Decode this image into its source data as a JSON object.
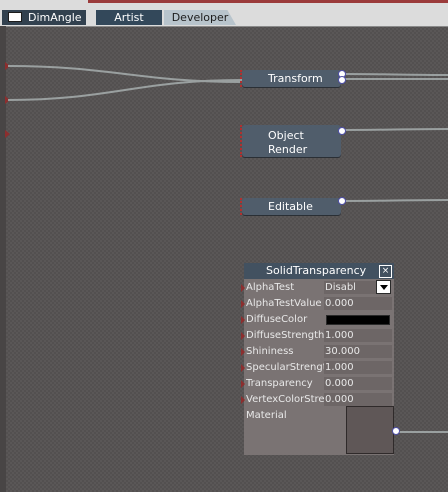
{
  "tabs": {
    "dimangle": "DimAngle",
    "artist": "Artist",
    "developer": "Developer"
  },
  "nodes": {
    "transform": "Transform",
    "object_render_line1": "Object",
    "object_render_line2": "Render",
    "editable": "Editable"
  },
  "panel": {
    "title": "SolidTransparency",
    "close": "×",
    "rows": [
      {
        "name": "AlphaTest",
        "value": "Disabl"
      },
      {
        "name": "AlphaTestValue",
        "value": "0.000"
      },
      {
        "name": "DiffuseColor",
        "value": ""
      },
      {
        "name": "DiffuseStrength",
        "value": "1.000"
      },
      {
        "name": "Shininess",
        "value": "30.000"
      },
      {
        "name": "SpecularStrengt",
        "value": "1.000"
      },
      {
        "name": "Transparency",
        "value": "0.000"
      },
      {
        "name": "VertexColorStre",
        "value": "0.000"
      },
      {
        "name": "Material",
        "value": ""
      }
    ],
    "diffuse_color": "#000000"
  },
  "colors": {
    "node_bg": "#505d6b",
    "panel_bg": "#7a7373",
    "panel_title_bg": "#425160",
    "port_red": "#8c2e2e",
    "wire": "#9aa0a0"
  },
  "icons": [
    "window-icon",
    "close-icon",
    "chevron-down-icon"
  ]
}
